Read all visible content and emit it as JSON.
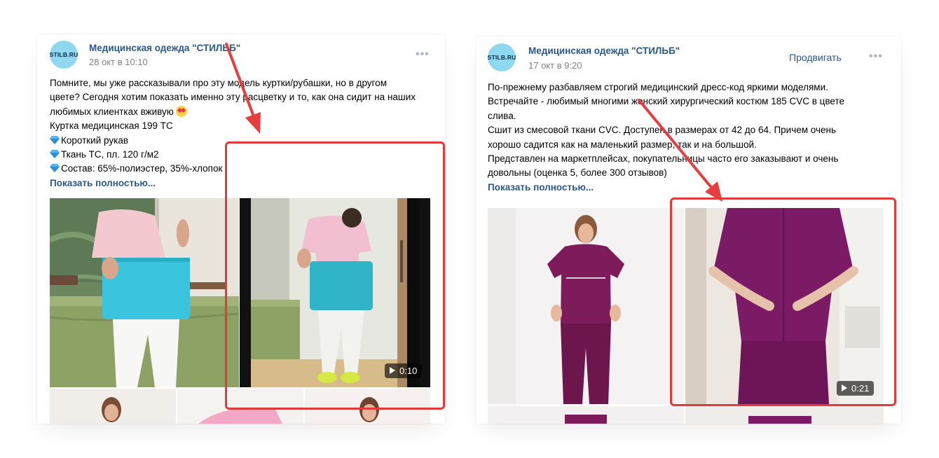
{
  "colors": {
    "link": "#2a5885",
    "date": "#828282",
    "avatar_bg": "#8fd9f0",
    "annotation_red": "#e03a3a",
    "arrow_red": "#e63e3e"
  },
  "posts": [
    {
      "avatar_text": "STILB.RU",
      "group_name": "Медицинская одежда \"СТИЛЬБ\"",
      "date": "28 окт в 10:10",
      "more_icon": "more-horizontal-icon",
      "more_label": "•••",
      "text_lines": [
        "Помните, мы уже рассказывали про эту модель куртки/рубашки, но в другом",
        "цвете? Сегодня хотим показать именно эту расцветку и то, как она сидит на наших",
        "любимых клиентках вживую",
        "Куртка медицинская 199 ТС",
        "Короткий рукав",
        "Ткань ТС, пл. 120 г/м2",
        "Состав: 65%-полиэстер, 35%-хлопок"
      ],
      "emoji_icon": "heart-eyes-emoji-icon",
      "bullet_icon": "gem-icon",
      "show_more": "Показать полностью...",
      "video_duration": "0:10",
      "play_icon": "play-icon"
    },
    {
      "avatar_text": "STILB.RU",
      "group_name": "Медицинская одежда \"СТИЛЬБ\"",
      "date": "17 окт в 9:20",
      "promote_label": "Продвигать",
      "more_icon": "more-horizontal-icon",
      "more_label": "•••",
      "text_lines": [
        "По-прежнему разбавляем строгий медицинский дресс-код яркими моделями.",
        "Встречайте - любимый многими женский хирургический костюм 185 CVC в цвете",
        "слива.",
        "Сшит из смесовой ткани CVC. Доступен в размерах от 42 до 64. Причем очень",
        "хорошо садится как на маленький размер, так и на большой.",
        "Представлен на маркетплейсах, покупательницы часто его заказывают и очень",
        "довольны (оценка 5, более 300 отзывов)"
      ],
      "show_more": "Показать полностью...",
      "video_duration": "0:21",
      "play_icon": "play-icon"
    }
  ]
}
